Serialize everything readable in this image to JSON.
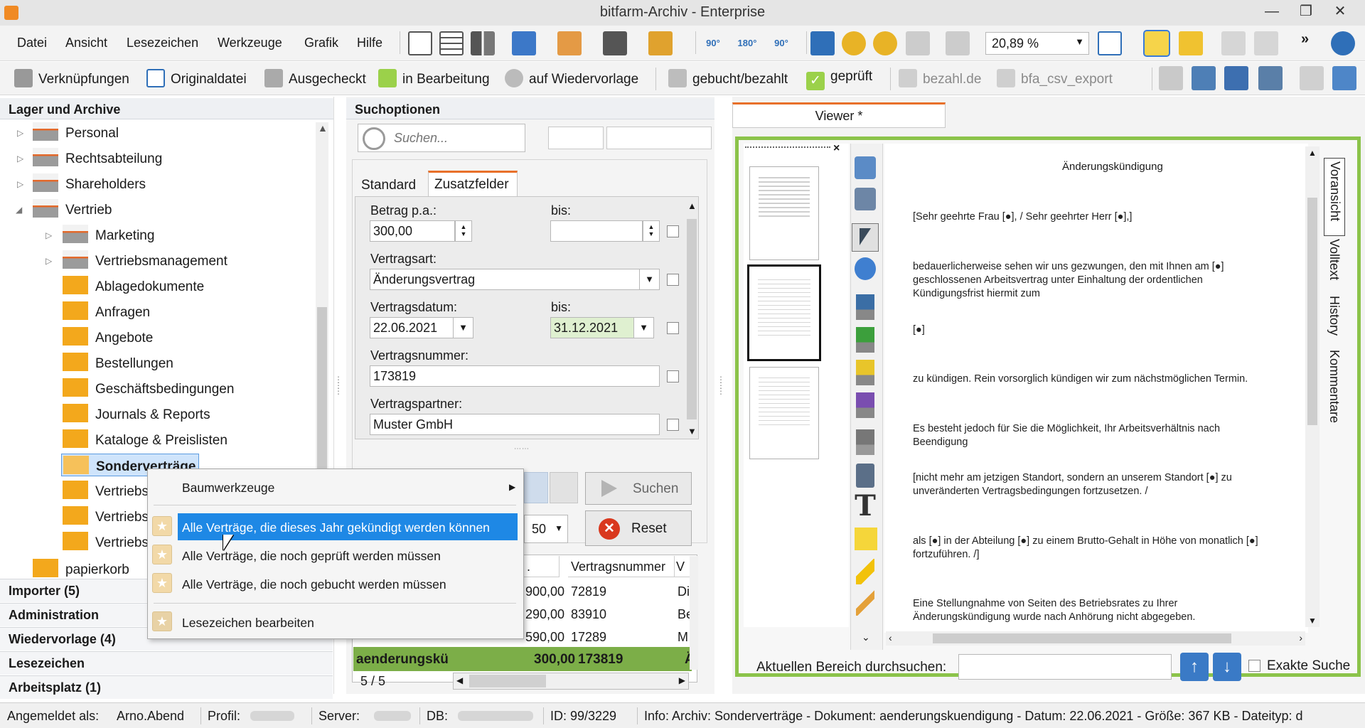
{
  "window": {
    "title": "bitfarm-Archiv - Enterprise",
    "minimize": "—",
    "maximize": "❐",
    "close": "✕"
  },
  "menu": [
    "Datei",
    "Ansicht",
    "Lesezeichen",
    "Werkzeuge",
    "Grafik",
    "Hilfe"
  ],
  "toolbar": {
    "zoom": "20,89 %",
    "rotate_labels": [
      "90°",
      "180°",
      "90°"
    ],
    "more": "»"
  },
  "toolbar2": {
    "items": [
      "Verknüpfungen",
      "Originaldatei",
      "Ausgecheckt",
      "in Bearbeitung",
      "auf Wiedervorlage",
      "gebucht/bezahlt",
      "geprüft",
      "bezahl.de",
      "bfa_csv_export"
    ]
  },
  "left": {
    "header": "Lager und Archive",
    "tree": [
      "Personal",
      "Rechtsabteilung",
      "Shareholders",
      "Vertrieb",
      "Marketing",
      "Vertriebsmanagement",
      "Ablagedokumente",
      "Anfragen",
      "Angebote",
      "Bestellungen",
      "Geschäftsbedingungen",
      "Journals & Reports",
      "Kataloge & Preislisten",
      "Sonderverträge",
      "Vertriebs",
      "Vertriebs",
      "Vertriebs",
      "papierkorb"
    ],
    "accordion": [
      "Importer (5)",
      "Administration",
      "Wiedervorlage (4)",
      "Lesezeichen",
      "Arbeitsplatz (1)"
    ]
  },
  "search": {
    "header": "Suchoptionen",
    "placeholder": "Suchen...",
    "tabs": [
      "Standard",
      "Zusatzfelder"
    ],
    "betrag_label": "Betrag p.a.:",
    "bis1": "bis:",
    "betrag_value": "300,00",
    "vertragsart_label": "Vertragsart:",
    "vertragsart_value": "Änderungsvertrag",
    "vertragsdatum_label": "Vertragsdatum:",
    "bis2": "bis:",
    "date_from": "22.06.2021",
    "date_to": "31.12.2021",
    "vertragsnummer_label": "Vertragsnummer:",
    "vertragsnummer_value": "173819",
    "vertragspartner_label": "Vertragspartner:",
    "vertragspartner_value": "Muster GmbH",
    "search_button": "Suchen",
    "reset_button": "Reset",
    "page_size": "50",
    "results": {
      "columns": [
        ".",
        "Vertragsnummer",
        "V"
      ],
      "rows": [
        {
          "amount": "900,00",
          "number": "72819",
          "v": "Di"
        },
        {
          "amount": "290,00",
          "number": "83910",
          "v": "Be"
        },
        {
          "amount": "590,00",
          "number": "17289",
          "v": "M"
        }
      ],
      "selected": {
        "name": "aenderungskü",
        "amount": "300,00",
        "number": "173819",
        "v": "Ä"
      },
      "pager": "5 / 5"
    }
  },
  "viewer": {
    "tab": "Viewer *",
    "side_tabs": [
      "Voransicht",
      "Volltext",
      "History",
      "Kommentare"
    ],
    "doc": {
      "title": "Änderungskündigung",
      "lines": [
        "[Sehr geehrte Frau [●], / Sehr geehrter Herr [●],]",
        "bedauerlicherweise sehen wir uns gezwungen, den mit Ihnen am [●] geschlossenen Arbeitsvertrag unter Einhaltung der ordentlichen Kündigungsfrist hiermit zum",
        "[●]",
        "zu kündigen. Rein vorsorglich kündigen wir zum nächstmöglichen Termin.",
        "Es besteht jedoch für Sie die Möglichkeit, Ihr Arbeitsverhältnis nach Beendigung",
        "[nicht mehr am jetzigen Standort, sondern an unserem Standort [●] zu unveränderten Vertragsbedingungen fortzusetzen. /",
        "als [●] in der Abteilung [●] zu einem Brutto-Gehalt in Höhe von monatlich [●] fortzuführen. /]",
        "Eine Stellungnahme von Seiten des Betriebsrates zu Ihrer Änderungskündigung wurde nach Anhörung nicht abgegeben."
      ]
    },
    "search_label": "Aktuellen Bereich durchsuchen:",
    "exact_search": "Exakte Suche"
  },
  "context_menu": {
    "tools": "Baumwerkzeuge",
    "bookmarks": [
      "Alle Verträge, die dieses Jahr gekündigt werden können",
      "Alle Verträge, die noch geprüft werden müssen",
      "Alle Verträge, die noch gebucht werden müssen"
    ],
    "edit": "Lesezeichen bearbeiten"
  },
  "status": {
    "logged_in_label": "Angemeldet als:",
    "user": "Arno.Abend",
    "profile_label": "Profil:",
    "server_label": "Server:",
    "db_label": "DB:",
    "id": "ID: 99/3229",
    "info": "Info: Archiv: Sonderverträge - Dokument: aenderungskuendigung - Datum: 22.06.2021 - Größe: 367 KB - Dateityp: d"
  },
  "colors": {
    "selection": "#1e88e5",
    "tab_accent": "#e8702a",
    "green_frame": "#8bc34a",
    "folder": "#f3a81c",
    "selected_row": "#7cae48"
  }
}
